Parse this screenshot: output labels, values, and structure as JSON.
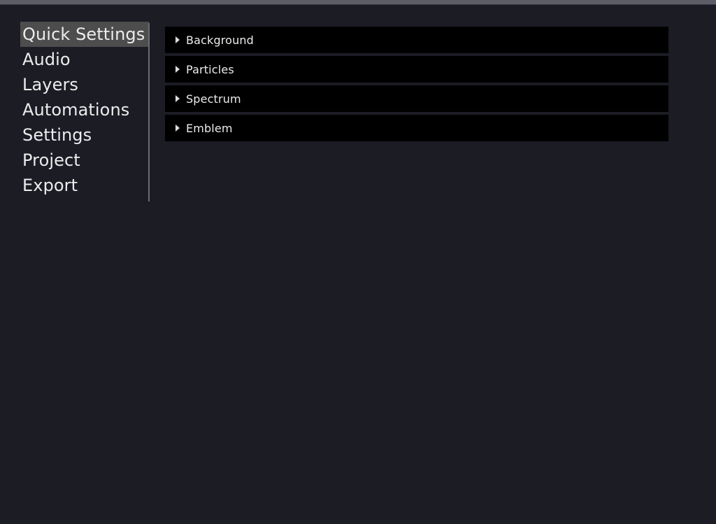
{
  "window": {
    "title_strip_color": "#5d5d66",
    "background_color": "#1c1c25"
  },
  "sidebar": {
    "selected_index": 0,
    "highlight_color": "#4d4d4d",
    "divider_color": "#6a6a72",
    "items": [
      {
        "label": "Quick Settings",
        "selected": true
      },
      {
        "label": "Audio",
        "selected": false
      },
      {
        "label": "Layers",
        "selected": false
      },
      {
        "label": "Automations",
        "selected": false
      },
      {
        "label": "Settings",
        "selected": false
      },
      {
        "label": "Project",
        "selected": false
      },
      {
        "label": "Export",
        "selected": false
      }
    ]
  },
  "main": {
    "panel_background_color": "#000000",
    "sections": [
      {
        "label": "Background",
        "expanded": false,
        "icon": "triangle-right-icon"
      },
      {
        "label": "Particles",
        "expanded": false,
        "icon": "triangle-right-icon"
      },
      {
        "label": "Spectrum",
        "expanded": false,
        "icon": "triangle-right-icon"
      },
      {
        "label": "Emblem",
        "expanded": false,
        "icon": "triangle-right-icon"
      }
    ]
  }
}
